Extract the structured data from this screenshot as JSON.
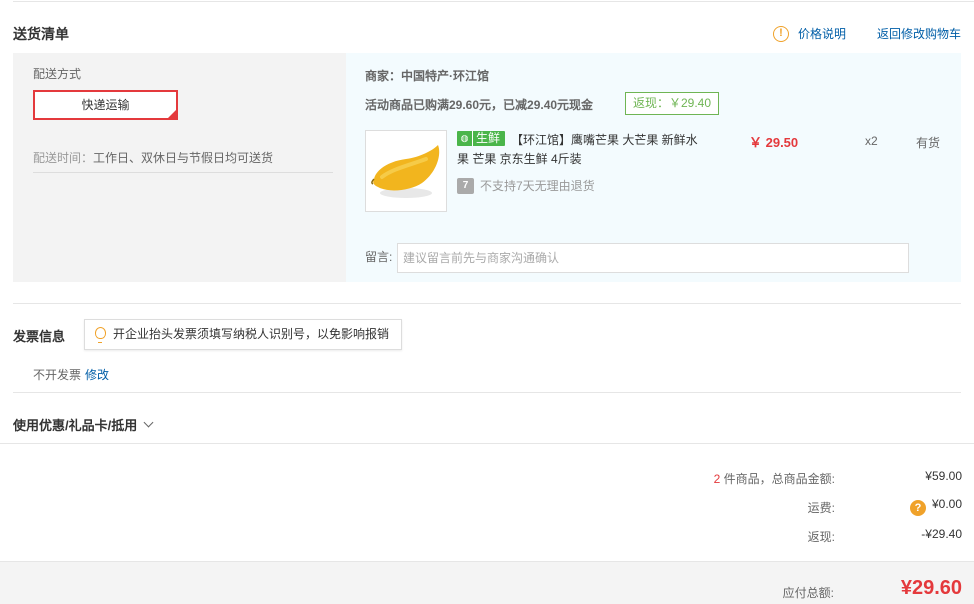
{
  "delivery": {
    "title": "送货清单",
    "price_explain": "价格说明",
    "back_to_cart": "返回修改购物车",
    "method_label": "配送方式",
    "method_value": "快递运输",
    "time_label": "配送时间：",
    "time_value": "工作日、双休日与节假日均可送货"
  },
  "shop": {
    "merchant": "商家：中国特产·环江馆",
    "promo": "活动商品已购满29.60元，已减29.40元现金",
    "rebate": "返现：￥29.40",
    "product": {
      "badge": "生鲜",
      "title": "【环江馆】鹰嘴芒果 大芒果 新鲜水果 芒果 京东生鲜 4斤装",
      "no_return": "不支持7天无理由退货",
      "no_return_icon_text": "7",
      "price": "￥ 29.50",
      "qty": "x2",
      "stock": "有货"
    },
    "message_label": "留言:",
    "message_placeholder": "建议留言前先与商家沟通确认"
  },
  "invoice": {
    "title": "发票信息",
    "tip": "开企业抬头发票须填写纳税人识别号，以免影响报销",
    "value": "不开发票",
    "edit": "修改"
  },
  "coupon": {
    "title": "使用优惠/礼品卡/抵用"
  },
  "summary": {
    "count": "2",
    "count_label": " 件商品，总商品金额:",
    "goods_amount": "¥59.00",
    "freight_label": "运费:",
    "freight_amount": "¥0.00",
    "rebate_label": "返现:",
    "rebate_amount": "-¥29.40",
    "total_label": "应付总额:",
    "total_amount": "¥29.60"
  },
  "colors": {
    "accent_red": "#e4393c",
    "link_blue": "#005ea7",
    "green": "#4ab54a",
    "orange": "#f0a22a"
  }
}
